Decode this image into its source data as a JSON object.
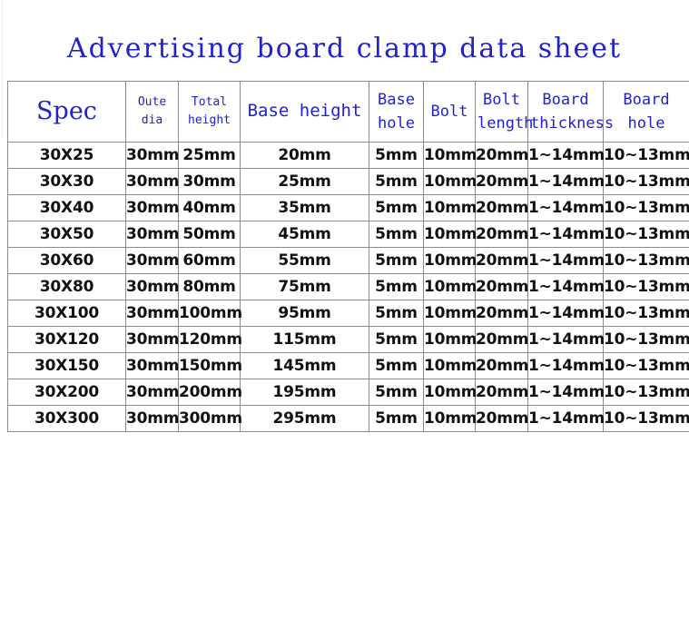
{
  "title": "Advertising board clamp data sheet",
  "table": {
    "headers": [
      "Spec",
      "Oute dia",
      "Total height",
      "Base height",
      "Base hole",
      "Bolt",
      "Bolt length",
      "Board thickness",
      "Board hole"
    ],
    "header_lines": {
      "spec": "Spec",
      "outer_dia_1": "Oute",
      "outer_dia_2": "dia",
      "total_height_1": "Total",
      "total_height_2": "height",
      "base_height": "Base height",
      "base_hole_1": "Base",
      "base_hole_2": "hole",
      "bolt": "Bolt",
      "bolt_length_1": "Bolt",
      "bolt_length_2": "length",
      "board_thickness_1": "Board",
      "board_thickness_2": "thickness",
      "board_hole": "Board hole"
    },
    "rows": [
      {
        "spec": "30X25",
        "outer_dia": "30mm",
        "total_height": "25mm",
        "base_height": "20mm",
        "base_hole": "5mm",
        "bolt": "10mm",
        "bolt_length": "20mm",
        "board_thickness": "1~14mm",
        "board_hole": "10~13mm"
      },
      {
        "spec": "30X30",
        "outer_dia": "30mm",
        "total_height": "30mm",
        "base_height": "25mm",
        "base_hole": "5mm",
        "bolt": "10mm",
        "bolt_length": "20mm",
        "board_thickness": "1~14mm",
        "board_hole": "10~13mm"
      },
      {
        "spec": "30X40",
        "outer_dia": "30mm",
        "total_height": "40mm",
        "base_height": "35mm",
        "base_hole": "5mm",
        "bolt": "10mm",
        "bolt_length": "20mm",
        "board_thickness": "1~14mm",
        "board_hole": "10~13mm"
      },
      {
        "spec": "30X50",
        "outer_dia": "30mm",
        "total_height": "50mm",
        "base_height": "45mm",
        "base_hole": "5mm",
        "bolt": "10mm",
        "bolt_length": "20mm",
        "board_thickness": "1~14mm",
        "board_hole": "10~13mm"
      },
      {
        "spec": "30X60",
        "outer_dia": "30mm",
        "total_height": "60mm",
        "base_height": "55mm",
        "base_hole": "5mm",
        "bolt": "10mm",
        "bolt_length": "20mm",
        "board_thickness": "1~14mm",
        "board_hole": "10~13mm"
      },
      {
        "spec": "30X80",
        "outer_dia": "30mm",
        "total_height": "80mm",
        "base_height": "75mm",
        "base_hole": "5mm",
        "bolt": "10mm",
        "bolt_length": "20mm",
        "board_thickness": "1~14mm",
        "board_hole": "10~13mm"
      },
      {
        "spec": "30X100",
        "outer_dia": "30mm",
        "total_height": "100mm",
        "base_height": "95mm",
        "base_hole": "5mm",
        "bolt": "10mm",
        "bolt_length": "20mm",
        "board_thickness": "1~14mm",
        "board_hole": "10~13mm"
      },
      {
        "spec": "30X120",
        "outer_dia": "30mm",
        "total_height": "120mm",
        "base_height": "115mm",
        "base_hole": "5mm",
        "bolt": "10mm",
        "bolt_length": "20mm",
        "board_thickness": "1~14mm",
        "board_hole": "10~13mm"
      },
      {
        "spec": "30X150",
        "outer_dia": "30mm",
        "total_height": "150mm",
        "base_height": "145mm",
        "base_hole": "5mm",
        "bolt": "10mm",
        "bolt_length": "20mm",
        "board_thickness": "1~14mm",
        "board_hole": "10~13mm"
      },
      {
        "spec": "30X200",
        "outer_dia": "30mm",
        "total_height": "200mm",
        "base_height": "195mm",
        "base_hole": "5mm",
        "bolt": "10mm",
        "bolt_length": "20mm",
        "board_thickness": "1~14mm",
        "board_hole": "10~13mm"
      },
      {
        "spec": "30X300",
        "outer_dia": "30mm",
        "total_height": "300mm",
        "base_height": "295mm",
        "base_hole": "5mm",
        "bolt": "10mm",
        "bolt_length": "20mm",
        "board_thickness": "1~14mm",
        "board_hole": "10~13mm"
      }
    ]
  },
  "colors": {
    "title_blue": "#2222cc",
    "header_blue": "#2222cc",
    "data_black": "#111111",
    "border_gray": "#8a8a8a",
    "background": "#ffffff"
  }
}
